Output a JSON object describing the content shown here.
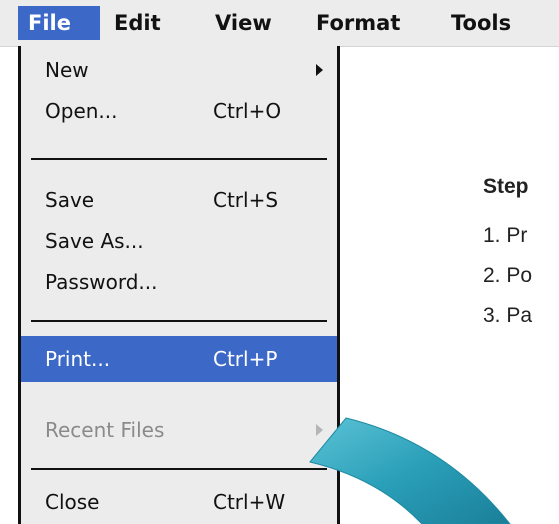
{
  "menubar": {
    "items": [
      {
        "label": "File",
        "active": true
      },
      {
        "label": "Edit"
      },
      {
        "label": "View"
      },
      {
        "label": "Format"
      },
      {
        "label": "Tools"
      }
    ]
  },
  "file_menu": {
    "items": [
      {
        "label": "New",
        "submenu": true
      },
      {
        "label": "Open...",
        "shortcut": "Ctrl+O"
      },
      {
        "label": "Save",
        "shortcut": "Ctrl+S"
      },
      {
        "label": "Save As..."
      },
      {
        "label": "Password..."
      },
      {
        "label": "Print...",
        "shortcut": "Ctrl+P",
        "highlighted": true
      },
      {
        "label": "Recent Files",
        "submenu": true,
        "disabled": true
      },
      {
        "label": "Close",
        "shortcut": "Ctrl+W"
      }
    ]
  },
  "content": {
    "step_title": "Step",
    "steps": [
      "1. Pr",
      "2. Po",
      "3. Pa"
    ]
  },
  "colors": {
    "highlight": "#3c69c7",
    "menu_bg": "#ececec",
    "arc": "#2a9fb8"
  },
  "icons": [
    "submenu-arrow-icon",
    "curved-arrow-graphic"
  ]
}
